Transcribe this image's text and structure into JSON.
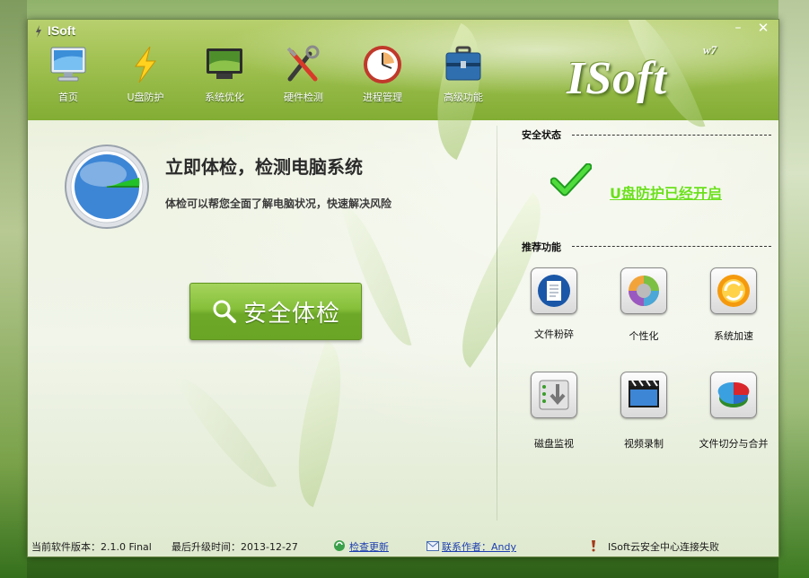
{
  "window": {
    "title": "ISoft",
    "minimize_glyph": "–",
    "close_glyph": "✕"
  },
  "brand": {
    "logo_text": "ISoft",
    "logo_sub": "w7"
  },
  "nav": {
    "items": [
      {
        "label": "首页",
        "icon": "monitor-icon"
      },
      {
        "label": "U盘防护",
        "icon": "lightning-icon"
      },
      {
        "label": "系统优化",
        "icon": "screen-icon"
      },
      {
        "label": "硬件检测",
        "icon": "tools-icon"
      },
      {
        "label": "进程管理",
        "icon": "clock-icon"
      },
      {
        "label": "高级功能",
        "icon": "toolbox-icon"
      }
    ]
  },
  "scan": {
    "title": "立即体检，检测电脑系统",
    "description": "体检可以帮您全面了解电脑状况，快速解决风险",
    "button_label": "安全体检",
    "button_icon": "search-icon"
  },
  "security": {
    "header": "安全状态",
    "status_text": "U盘防护已经开启",
    "status_icon": "checkmark-icon"
  },
  "features": {
    "header": "推荐功能",
    "items": [
      {
        "label": "文件粉碎",
        "icon": "document-shred-icon"
      },
      {
        "label": "个性化",
        "icon": "color-wheel-icon"
      },
      {
        "label": "系统加速",
        "icon": "refresh-speed-icon"
      },
      {
        "label": "磁盘监视",
        "icon": "disk-monitor-icon"
      },
      {
        "label": "视频录制",
        "icon": "video-clapper-icon"
      },
      {
        "label": "文件切分与合并",
        "icon": "pie-split-icon"
      }
    ]
  },
  "statusbar": {
    "version": "当前软件版本：2.1.0 Final",
    "last_update": "最后升级时间：2013-12-27",
    "check_update": "检查更新",
    "contact": "联系作者：Andy",
    "cloud_status": "ISoft云安全中心连接失败"
  },
  "colors": {
    "accent_green": "#86c03a",
    "status_green": "#6be01c",
    "link_blue": "#1e3fb0"
  }
}
